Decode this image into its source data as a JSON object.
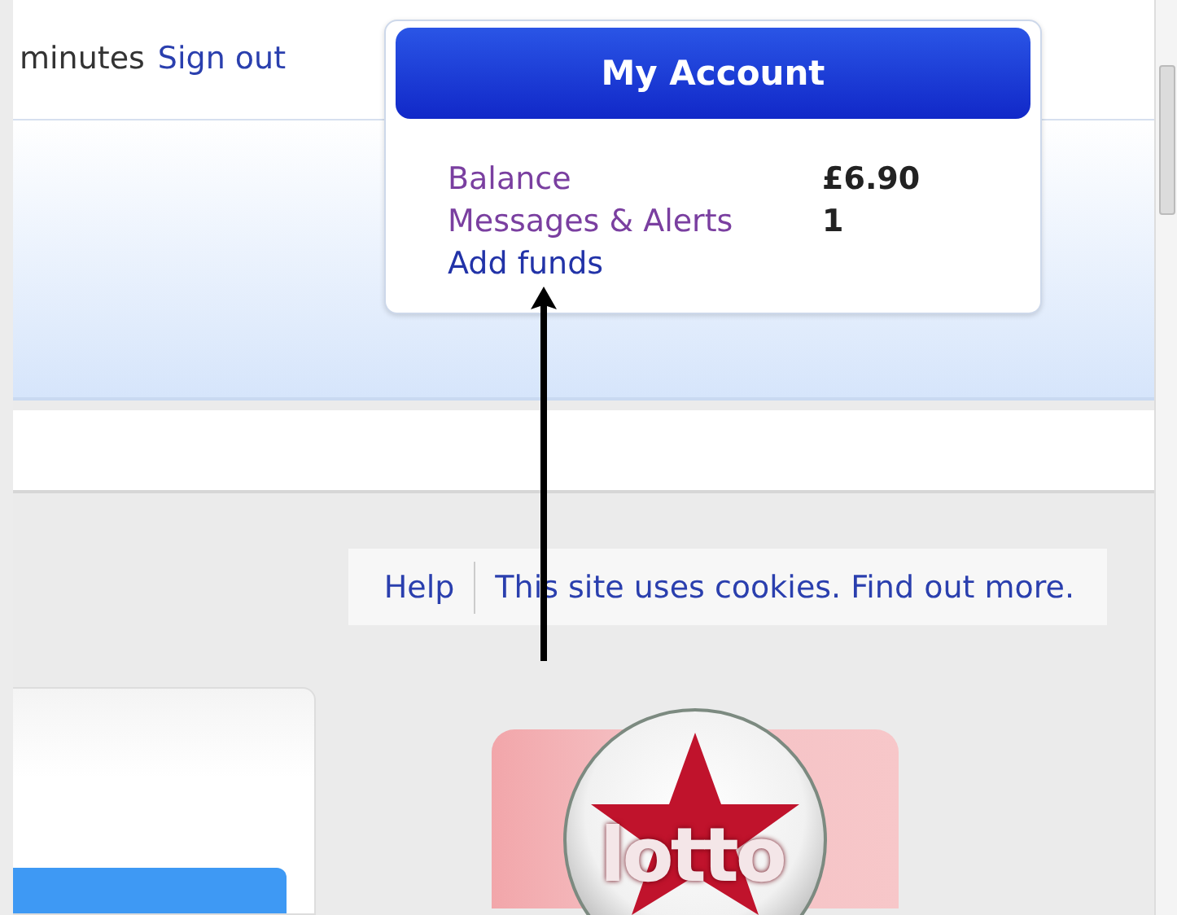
{
  "header": {
    "session_text": "minutes",
    "sign_out": "Sign out"
  },
  "account": {
    "title": "My Account",
    "rows": [
      {
        "label": "Balance",
        "value": "£6.90"
      },
      {
        "label": "Messages & Alerts",
        "value": "1"
      }
    ],
    "add_funds": "Add funds"
  },
  "footer_links": [
    {
      "label": "Help"
    },
    {
      "label": "This site uses cookies. Find out more."
    }
  ],
  "lotto_logo": {
    "text": "lotto"
  }
}
